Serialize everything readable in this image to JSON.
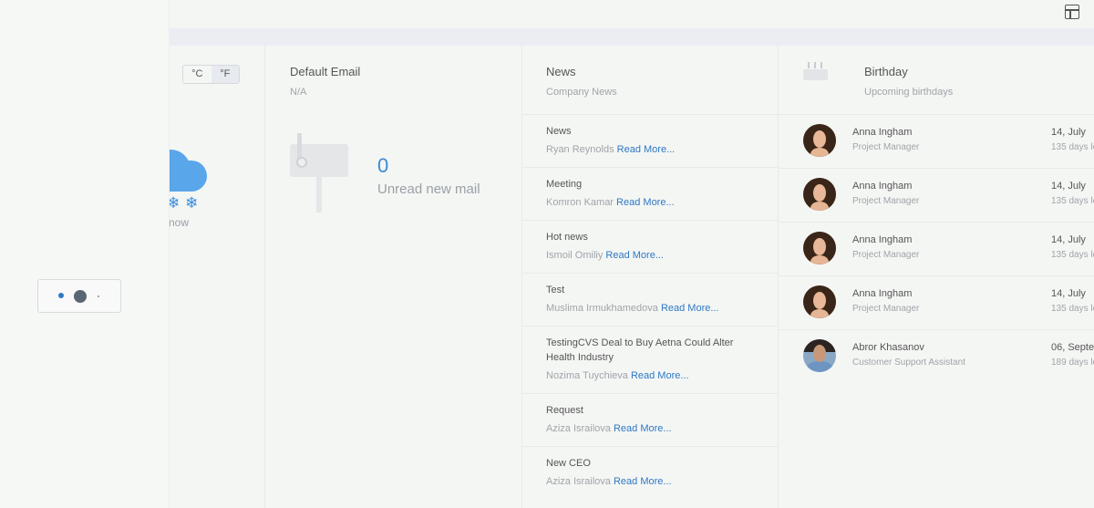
{
  "weather": {
    "unit_celsius": "°C",
    "unit_fahrenheit": "°F",
    "status": "now",
    "icon": "cloud-snow-icon"
  },
  "email": {
    "title": "Default Email",
    "subtitle": "N/A",
    "unread_count": "0",
    "unread_label": "Unread new mail",
    "icon": "mailbox-icon"
  },
  "news": {
    "title": "News",
    "subtitle": "Company News",
    "items": [
      {
        "title": "News",
        "author": "Ryan Reynolds",
        "read_more": "Read More..."
      },
      {
        "title": "Meeting",
        "author": "Komron Kamar",
        "read_more": "Read More..."
      },
      {
        "title": "Hot news",
        "author": "Ismoil Omiliy",
        "read_more": "Read More..."
      },
      {
        "title": "Test",
        "author": "Muslima Irmukhamedova",
        "read_more": "Read More..."
      },
      {
        "title": "TestingCVS Deal to Buy Aetna Could Alter Health Industry",
        "author": "Nozima Tuychieva",
        "read_more": "Read More..."
      },
      {
        "title": "Request",
        "author": "Aziza Israilova",
        "read_more": "Read More..."
      },
      {
        "title": "New CEO",
        "author": "Aziza Israilova",
        "read_more": "Read More..."
      }
    ]
  },
  "birthday": {
    "title": "Birthday",
    "subtitle": "Upcoming birthdays",
    "icon": "birthday-cake-icon",
    "items": [
      {
        "name": "Anna Ingham",
        "role": "Project Manager",
        "date": "14, July",
        "days": "135 days le"
      },
      {
        "name": "Anna Ingham",
        "role": "Project Manager",
        "date": "14, July",
        "days": "135 days le"
      },
      {
        "name": "Anna Ingham",
        "role": "Project Manager",
        "date": "14, July",
        "days": "135 days le"
      },
      {
        "name": "Anna Ingham",
        "role": "Project Manager",
        "date": "14, July",
        "days": "135 days le"
      },
      {
        "name": "Abror Khasanov",
        "role": "Customer Support Assistant",
        "date": "06, Septe",
        "days": "189 days le"
      }
    ]
  },
  "colors": {
    "accent": "#2f78c4",
    "weather_icon": "#5aa6ea"
  }
}
